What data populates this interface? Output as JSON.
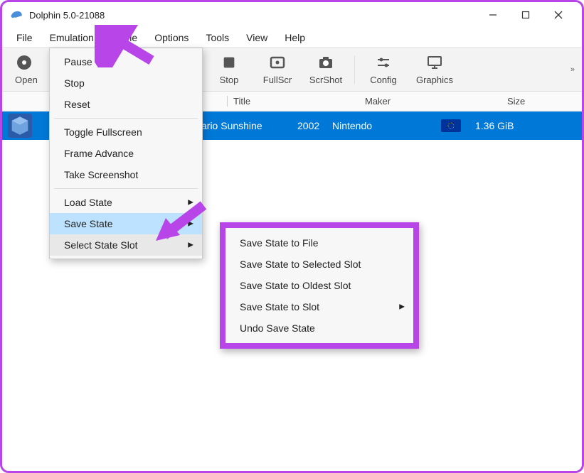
{
  "window": {
    "title": "Dolphin 5.0-21088"
  },
  "menubar": [
    "File",
    "Emulation",
    "Movie",
    "Options",
    "Tools",
    "View",
    "Help"
  ],
  "toolbar": {
    "open": "Open",
    "stop": "Stop",
    "fullscr": "FullScr",
    "scrshot": "ScrShot",
    "config": "Config",
    "graphics": "Graphics"
  },
  "columns": {
    "title": "Title",
    "maker": "Maker",
    "size": "Size"
  },
  "game": {
    "title_partial": "ario Sunshine",
    "year": "2002",
    "maker": "Nintendo",
    "size": "1.36 GiB"
  },
  "emulation_menu": {
    "pause": "Pause",
    "stop": "Stop",
    "reset": "Reset",
    "toggle_fullscreen": "Toggle Fullscreen",
    "frame_advance": "Frame Advance",
    "take_screenshot": "Take Screenshot",
    "load_state": "Load State",
    "save_state": "Save State",
    "select_state_slot": "Select State Slot"
  },
  "save_state_submenu": {
    "to_file": "Save State to File",
    "to_selected": "Save State to Selected Slot",
    "to_oldest": "Save State to Oldest Slot",
    "to_slot": "Save State to Slot",
    "undo": "Undo Save State"
  },
  "annotation_color": "#b845e8"
}
